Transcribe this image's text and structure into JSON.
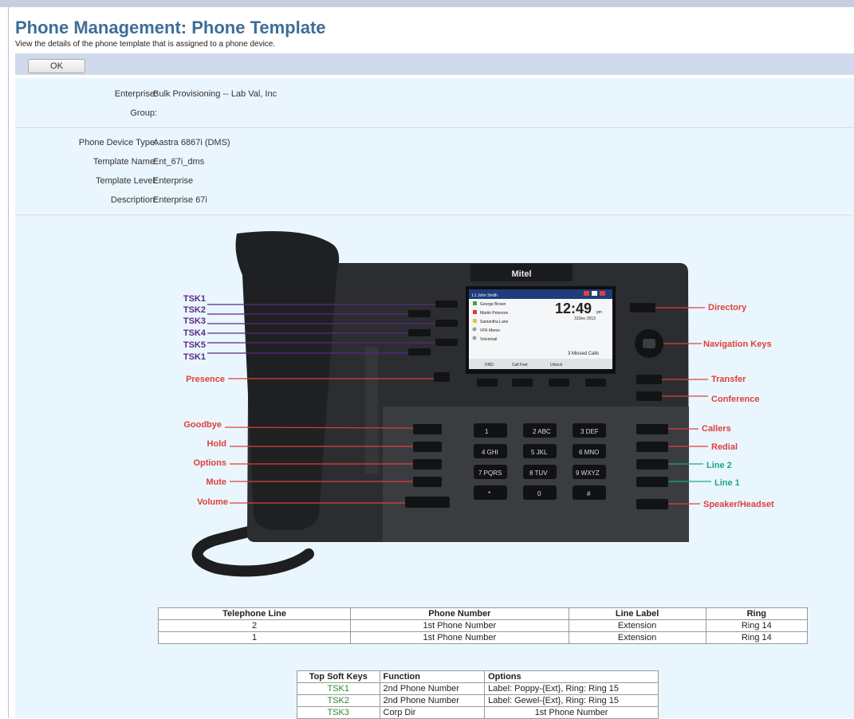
{
  "header": {
    "title": "Phone Management: Phone Template",
    "subtitle": "View the details of the phone template that is assigned to a phone device."
  },
  "toolbar": {
    "ok_label": "OK"
  },
  "details": {
    "enterprise_label": "Enterprise:",
    "enterprise_value": "Bulk Provisioning -- Lab Val, Inc",
    "group_label": "Group:",
    "group_value": "",
    "device_type_label": "Phone Device Type:",
    "device_type_value": "Aastra 6867i (DMS)",
    "template_name_label": "Template Name:",
    "template_name_value": "Ent_67i_dms",
    "template_level_label": "Template Level:",
    "template_level_value": "Enterprise",
    "description_label": "Description:",
    "description_value": "Enterprise 67i"
  },
  "phone_image": {
    "brand": "Mitel",
    "screen_name": "L1 John Smith",
    "screen_contacts": [
      "George Brown",
      "Martin Peterson",
      "Samantha Lane",
      "VFK Memo",
      "Voicemail"
    ],
    "screen_time": "12:49",
    "screen_ampm": "pm",
    "screen_date": "31Dec 2013",
    "screen_missed": "3 Missed Calls",
    "screen_softkeys": [
      "DND",
      "Call Fwd",
      "Unlock"
    ],
    "dial_keys": [
      "1",
      "2 ABC",
      "3 DEF",
      "4 GHI",
      "5 JKL",
      "6 MNO",
      "7 PQRS",
      "8 TUV",
      "9 WXYZ",
      "*",
      "0",
      "#"
    ],
    "left_callouts": [
      "TSK1",
      "TSK2",
      "TSK3",
      "TSK4",
      "TSK5",
      "TSK1",
      "Presence",
      "Goodbye",
      "Hold",
      "Options",
      "Mute",
      "Volume"
    ],
    "right_callouts": [
      "Directory",
      "Navigation Keys",
      "Transfer",
      "Conference",
      "Callers",
      "Redial",
      "Line 2",
      "Line 1",
      "Speaker/Headset"
    ],
    "colors": {
      "tsk": "#5b2a86",
      "red": "#e0403a",
      "line": "#1aa58a",
      "body": "#2b2d30"
    }
  },
  "lines_table": {
    "headers": [
      "Telephone Line",
      "Phone Number",
      "Line Label",
      "Ring"
    ],
    "rows": [
      [
        "2",
        "1st Phone Number",
        "Extension",
        "Ring 14"
      ],
      [
        "1",
        "1st Phone Number",
        "Extension",
        "Ring 14"
      ]
    ]
  },
  "softkeys_table": {
    "headers": [
      "Top Soft Keys",
      "Function",
      "Options"
    ],
    "rows": [
      [
        "TSK1",
        "2nd Phone Number",
        "Label: Poppy-{Ext}, Ring: Ring 15"
      ],
      [
        "TSK2",
        "2nd Phone Number",
        "Label: Gewel-{Ext}, Ring: Ring 15"
      ],
      [
        "TSK3",
        "Corp Dir",
        "1st Phone Number"
      ]
    ]
  }
}
